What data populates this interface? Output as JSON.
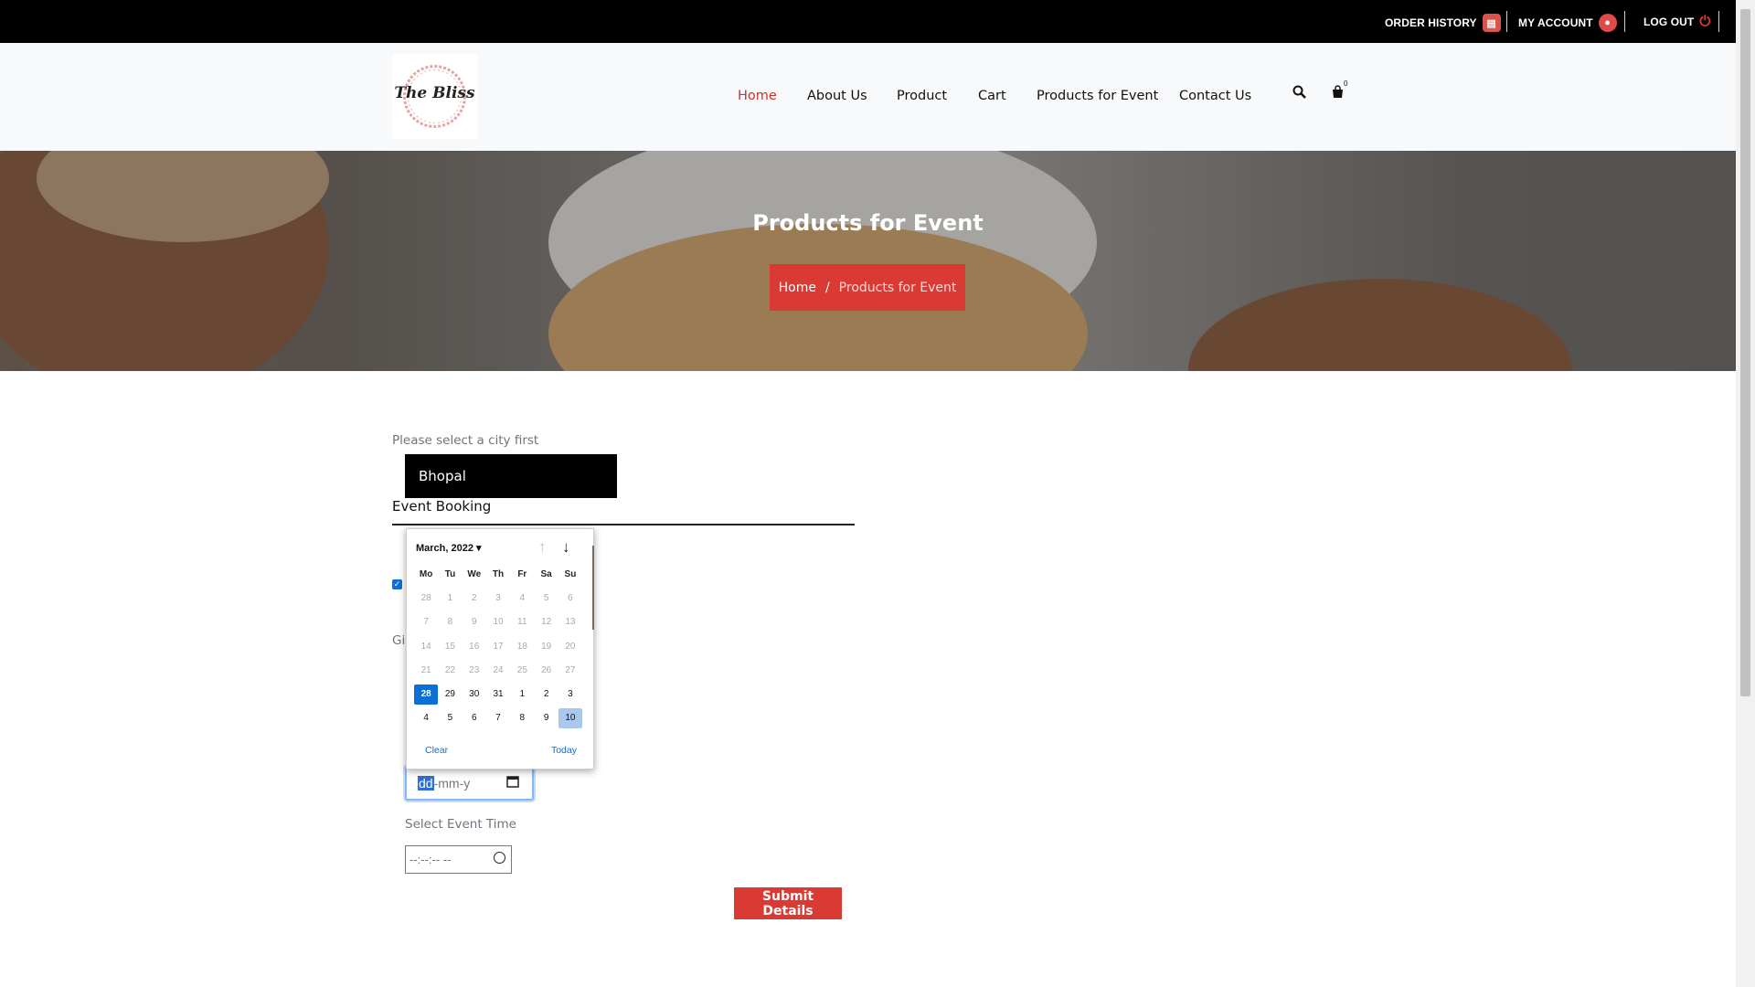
{
  "topbar": {
    "order_history": "ORDER HISTORY",
    "my_account": "MY ACCOUNT",
    "log_out": "LOG OUT"
  },
  "header": {
    "logo_text": "The Bliss",
    "nav": [
      "Home",
      "About Us",
      "Product",
      "Cart",
      "Products for Event",
      "Contact Us"
    ],
    "active_nav": "Home",
    "cart_count": "0"
  },
  "banner": {
    "title": "Products for Event",
    "breadcrumb_home": "Home",
    "breadcrumb_sep": "/",
    "breadcrumb_current": "Products for Event"
  },
  "form": {
    "city_label": "Please select a city first",
    "city_value": "Bhopal",
    "section_title": "Event Booking",
    "gi_fragment": "Gi",
    "date_placeholder_sel": "dd",
    "date_placeholder_rest": "-mm-y",
    "time_label": "Select Event Time",
    "time_placeholder": "--:--:-- --",
    "submit": "Submit Details"
  },
  "calendar": {
    "month_label": "March, 2022 ▾",
    "weekdays": [
      "Mo",
      "Tu",
      "We",
      "Th",
      "Fr",
      "Sa",
      "Su"
    ],
    "weeks": [
      [
        "28",
        "1",
        "2",
        "3",
        "4",
        "5",
        "6"
      ],
      [
        "7",
        "8",
        "9",
        "10",
        "11",
        "12",
        "13"
      ],
      [
        "14",
        "15",
        "16",
        "17",
        "18",
        "19",
        "20"
      ],
      [
        "21",
        "22",
        "23",
        "24",
        "25",
        "26",
        "27"
      ],
      [
        "28",
        "29",
        "30",
        "31",
        "1",
        "2",
        "3"
      ],
      [
        "4",
        "5",
        "6",
        "7",
        "8",
        "9",
        "10"
      ]
    ],
    "clear": "Clear",
    "today": "Today"
  },
  "colors": {
    "accent_red": "#d93a33",
    "nav_active": "#c8322b",
    "calendar_blue": "#0b6fd6"
  }
}
